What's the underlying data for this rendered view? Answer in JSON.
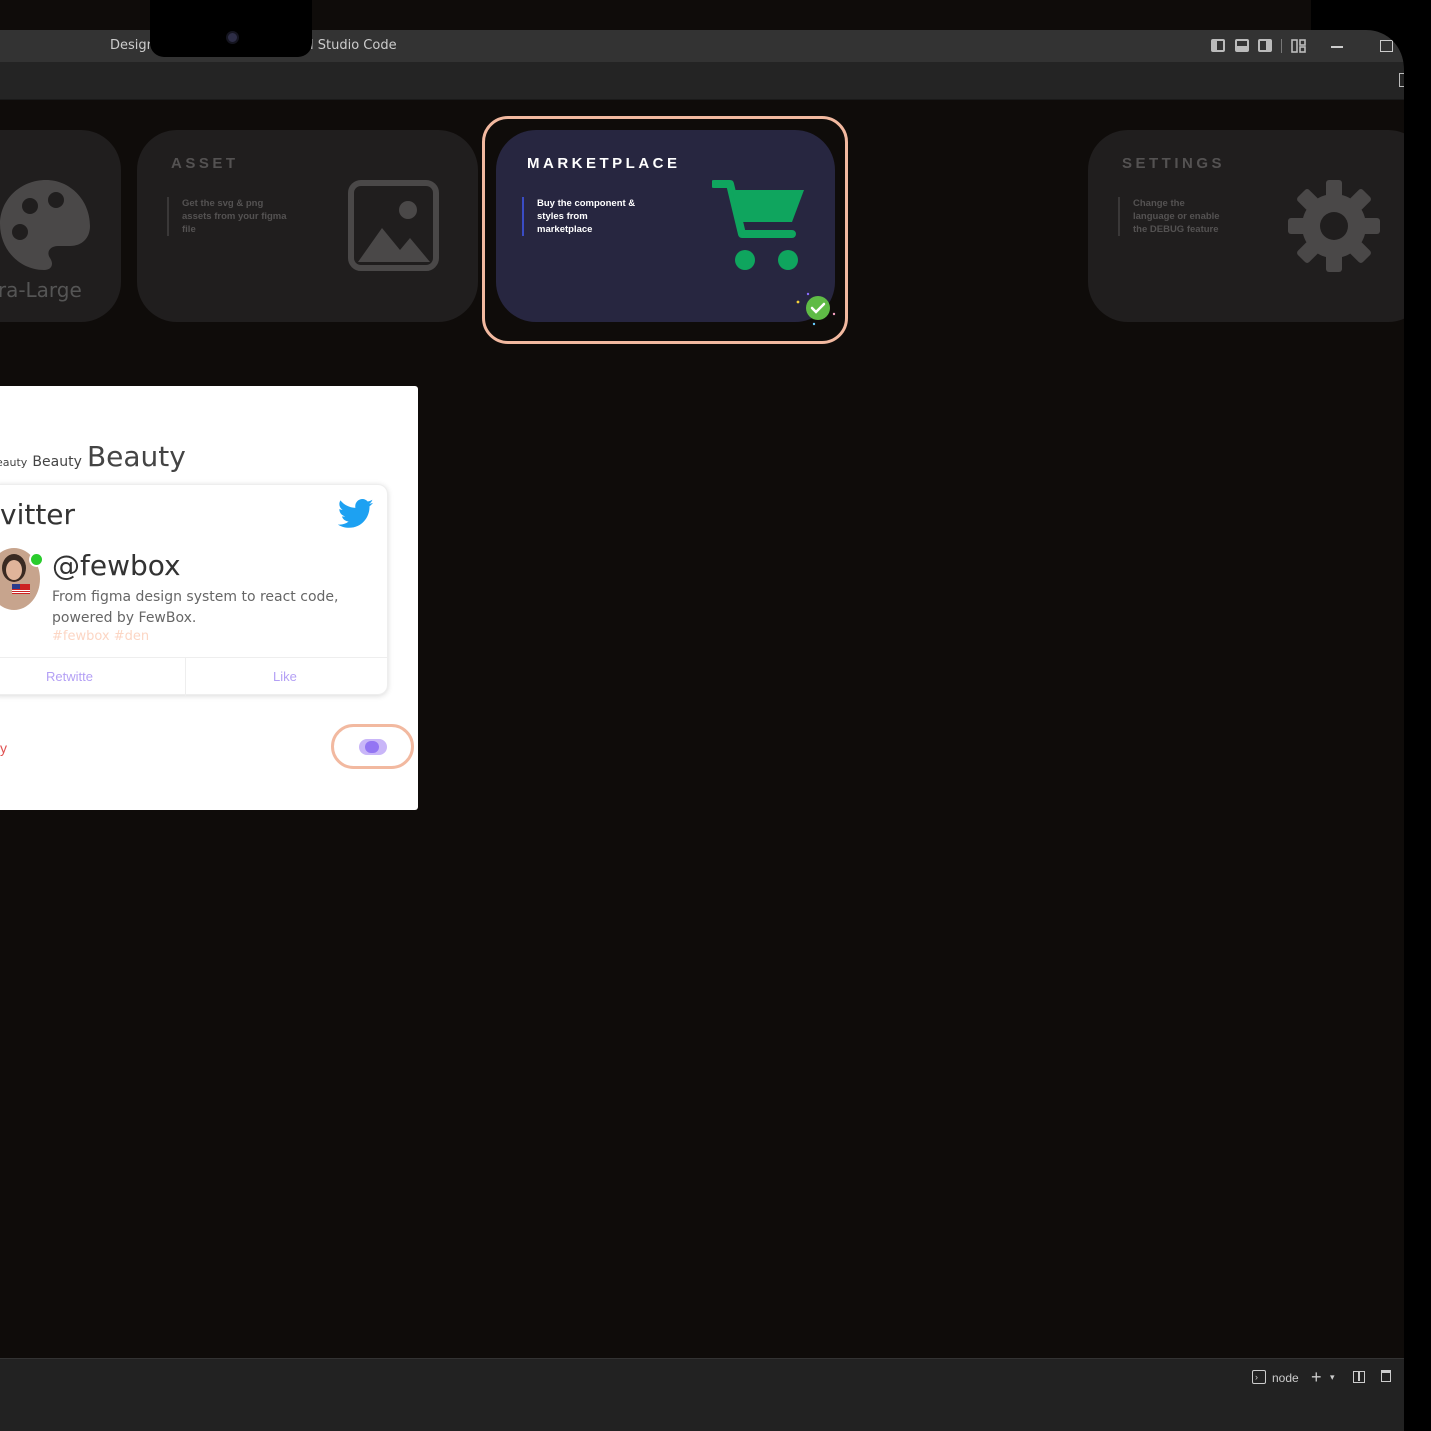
{
  "titlebar": {
    "left_title": "Design",
    "right_title": "l Studio Code"
  },
  "cards": [
    {
      "label": "tra-Large"
    },
    {
      "title": "ASSET",
      "desc": "Get the svg & png assets from your figma file"
    },
    {
      "title": "MARKETPLACE",
      "desc": "Buy the component & styles from marketplace"
    },
    {
      "title": "SETTINGS",
      "desc": "Change the language or enable the DEBUG feature"
    }
  ],
  "breadcrumb": {
    "small": "eauty",
    "medium": "Beauty",
    "large": "Beauty"
  },
  "twitter": {
    "title": "vitter",
    "handle": "@fewbox",
    "text": "From figma design system to react code, powered by FewBox.",
    "tags": "#fewbox  #den",
    "retweet": "Retwitte",
    "like": "Like"
  },
  "red_label": "y",
  "terminal": {
    "label": "node"
  },
  "colors": {
    "accent_outline": "#f2b9a0",
    "marketplace_bg": "#272640",
    "cart_green": "#0fa55e",
    "toggle": "#9375f3"
  }
}
